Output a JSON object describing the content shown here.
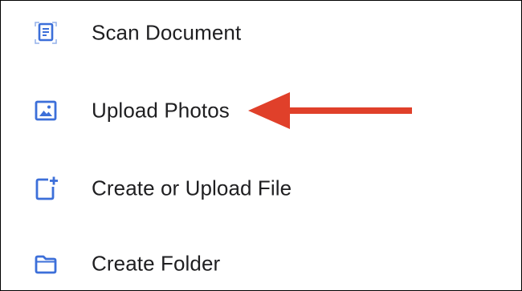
{
  "menu": {
    "items": [
      {
        "label": "Scan Document",
        "icon": "scan-document-icon"
      },
      {
        "label": "Upload Photos",
        "icon": "photo-icon"
      },
      {
        "label": "Create or Upload File",
        "icon": "new-file-icon"
      },
      {
        "label": "Create Folder",
        "icon": "folder-icon"
      }
    ]
  },
  "annotation": {
    "icon": "red-arrow-pointing-left",
    "target": "Upload Photos"
  },
  "colors": {
    "icon_blue": "#3c6fd9",
    "arrow_red": "#e0402a",
    "text": "#1f1f21",
    "background": "#ffffff"
  }
}
